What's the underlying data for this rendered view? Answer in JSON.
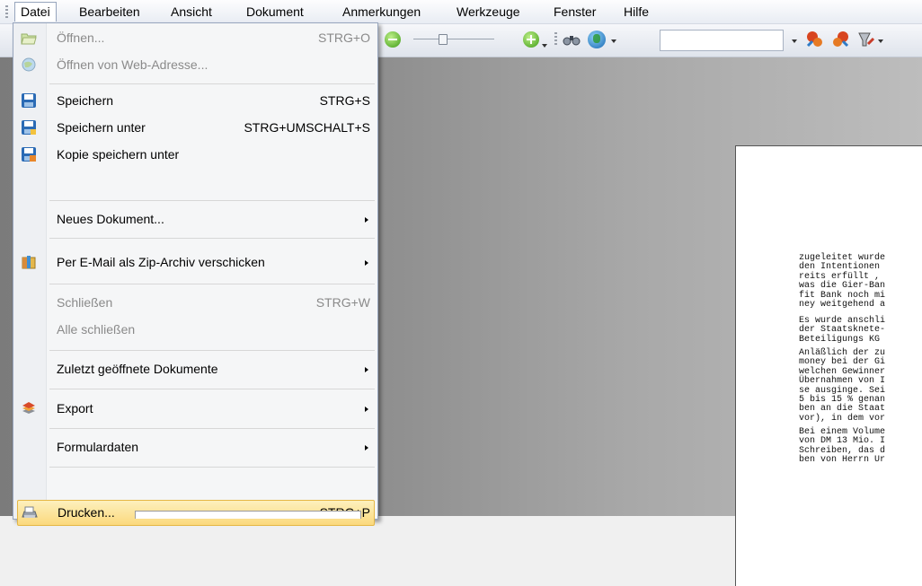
{
  "menubar": {
    "items": [
      "Datei",
      "Bearbeiten",
      "Ansicht",
      "Dokument",
      "Anmerkungen",
      "Werkzeuge",
      "Fenster",
      "Hilfe"
    ]
  },
  "toolbar": {
    "search_value": ""
  },
  "file_menu": {
    "open": {
      "label": "Öffnen...",
      "shortcut": "STRG+O"
    },
    "open_web": {
      "label": "Öffnen von Web-Adresse..."
    },
    "save": {
      "label": "Speichern",
      "shortcut": "STRG+S"
    },
    "save_as": {
      "label": "Speichern unter",
      "shortcut": "STRG+UMSCHALT+S"
    },
    "save_copy": {
      "label": "Kopie speichern unter"
    },
    "new_doc": {
      "label": "Neues Dokument..."
    },
    "email_zip": {
      "label": "Per E-Mail als Zip-Archiv verschicken"
    },
    "close": {
      "label": "Schließen",
      "shortcut": "STRG+W"
    },
    "close_all": {
      "label": "Alle schließen"
    },
    "recent": {
      "label": "Zuletzt geöffnete Dokumente"
    },
    "export": {
      "label": "Export"
    },
    "form_data": {
      "label": "Formulardaten"
    },
    "print": {
      "label": "Drucken...",
      "shortcut": "STRG+P"
    }
  },
  "document": {
    "paragraphs": [
      "zugeleitet wurde\nden Intentionen\nreits erfüllt ,\nwas die Gier-Ban\nfit Bank noch mi\nney weitgehend a",
      "Es wurde anschli\nder Staatsknete-\nBeteiligungs KG",
      "Anläßlich der zu\nmoney bei der Gi\nwelchen Gewinner\nÜbernahmen von I\nse ausginge. Sei\n5 bis 15 % genan\nben an die Staat\nvor), in dem vor",
      "Bei einem Volume\nvon DM 13 Mio. I\nSchreiben, das d\nben von Herrn Ur"
    ]
  },
  "colors": {
    "highlight_top": "#fdf0bd",
    "highlight_bottom": "#fbd97d",
    "menu_border": "#97a5bd"
  }
}
